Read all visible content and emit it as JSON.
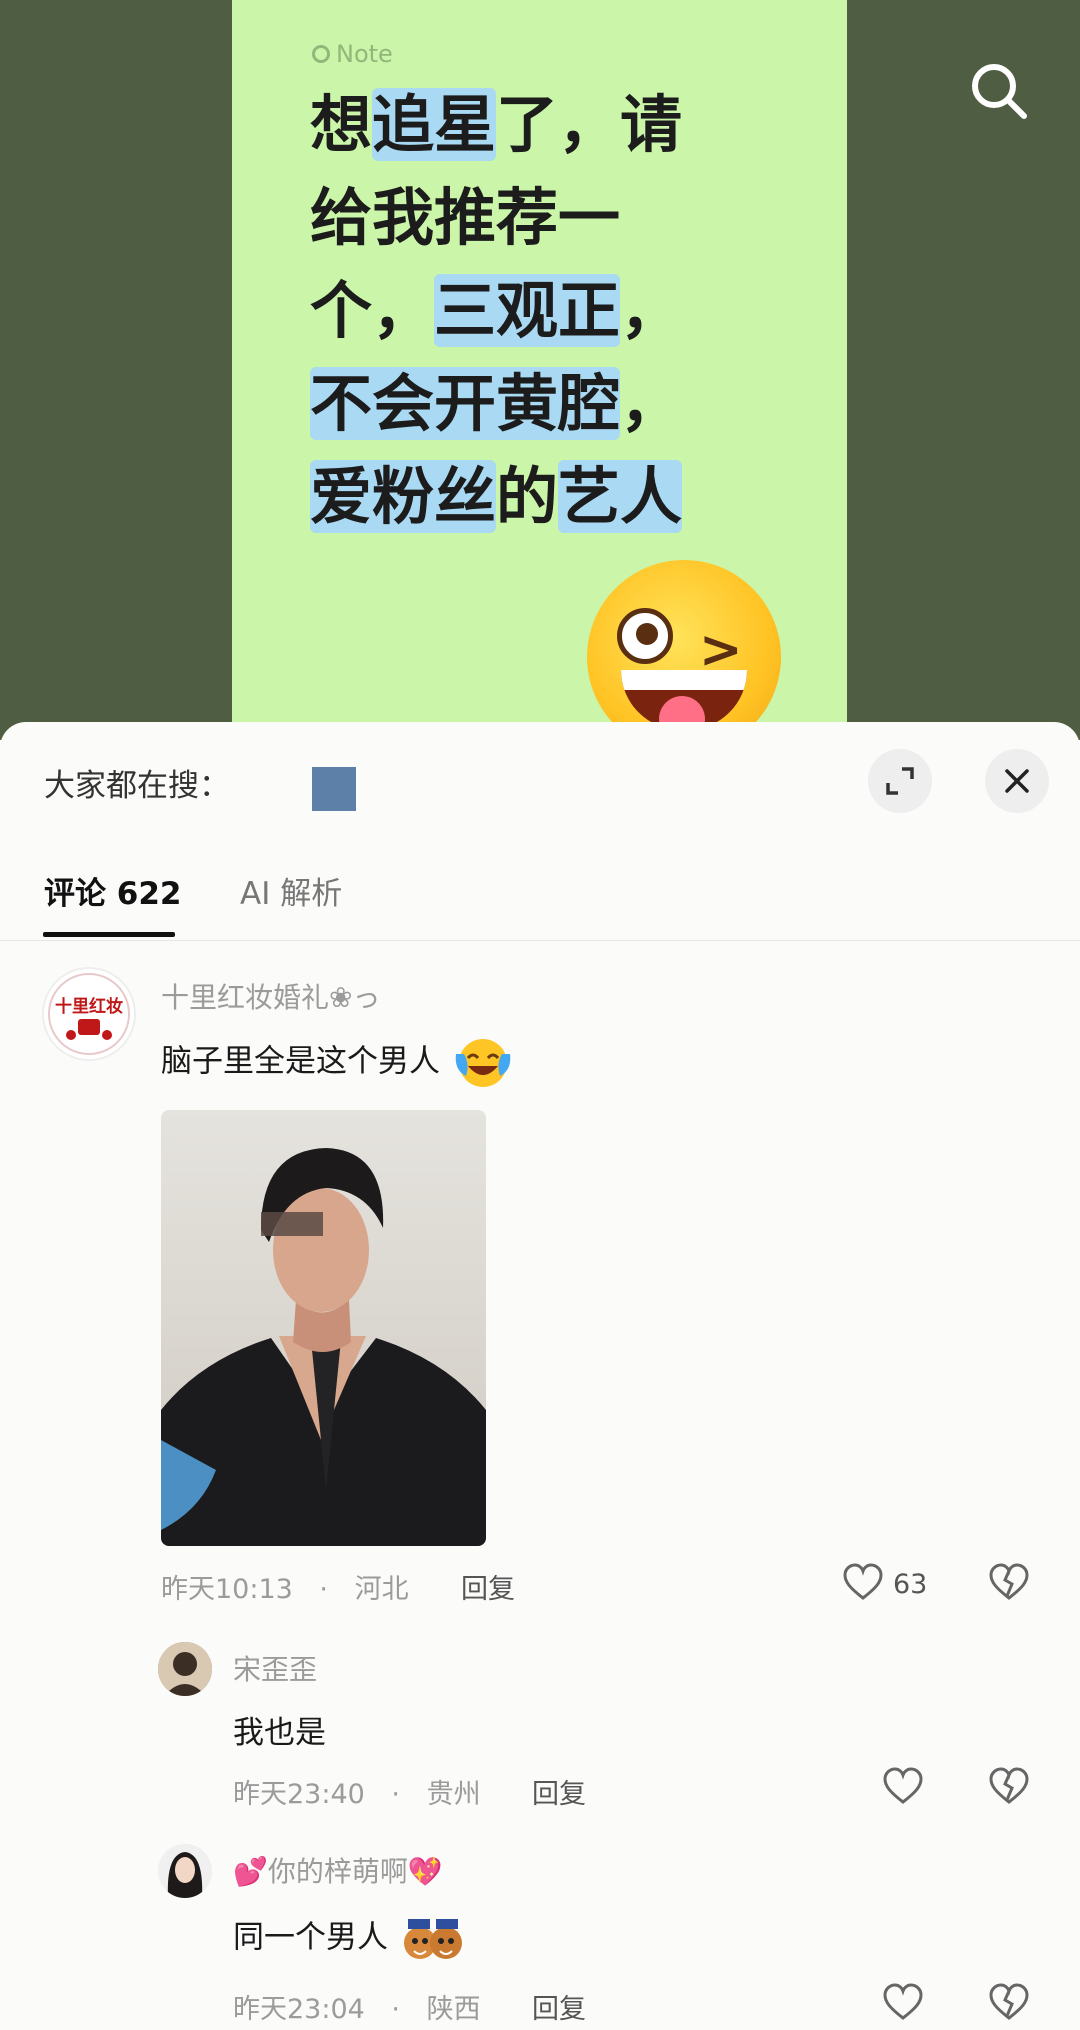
{
  "note": {
    "tag": "Note",
    "lines": [
      [
        {
          "t": "想",
          "h": false
        },
        {
          "t": "追星",
          "h": true
        },
        {
          "t": "了，请",
          "h": false
        }
      ],
      [
        {
          "t": "给我推荐一",
          "h": false
        }
      ],
      [
        {
          "t": "个，",
          "h": false
        },
        {
          "t": "三观正",
          "h": true
        },
        {
          "t": "，",
          "h": false
        }
      ],
      [
        {
          "t": "不会开黄腔",
          "h": true
        },
        {
          "t": "，",
          "h": false
        }
      ],
      [
        {
          "t": "爱粉丝",
          "h": true
        },
        {
          "t": "的",
          "h": false
        },
        {
          "t": "艺人",
          "h": true
        }
      ]
    ]
  },
  "sheet": {
    "trending_label": "大家都在搜：",
    "tabs": {
      "comments": "评论",
      "comments_count": "622",
      "ai": "AI  解析"
    }
  },
  "comments": [
    {
      "user": "十里红妆婚礼❀っ",
      "avatar_text": "十里红妆",
      "text": "脑子里全是这个男人",
      "emoji": "laughing-crying-emoji",
      "time": "昨天10:13",
      "location": "河北",
      "reply": "回复",
      "likes": "63"
    },
    {
      "user": "宋歪歪",
      "text": "我也是",
      "time": "昨天23:40",
      "location": "贵州",
      "reply": "回复"
    },
    {
      "user": "你的梓萌啊",
      "text": "同一个男人",
      "emoji": "cartoon-pair-sticker",
      "time": "昨天23:04",
      "location": "陕西",
      "reply": "回复"
    }
  ],
  "sep": "·",
  "colors": {
    "top_bg": "#4f5e43",
    "note_bg": "#cbf5a9",
    "highlight": "#a9d9f3"
  }
}
